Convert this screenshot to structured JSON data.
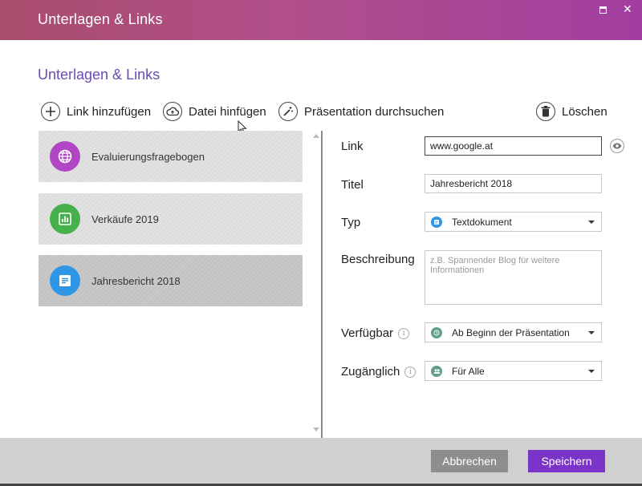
{
  "window": {
    "title": "Unterlagen & Links"
  },
  "heading": "Unterlagen & Links",
  "toolbar": {
    "add_link": "Link hinzufügen",
    "add_file": "Datei hinfügen",
    "search_presentation": "Präsentation durchsuchen",
    "delete": "Löschen"
  },
  "list": {
    "items": [
      {
        "label": "Evaluierungsfragebogen",
        "icon": "globe-icon",
        "color": "#b046c4"
      },
      {
        "label": "Verkäufe 2019",
        "icon": "bar-chart-icon",
        "color": "#46b14c"
      },
      {
        "label": "Jahresbericht 2018",
        "icon": "document-icon",
        "color": "#2f96e6",
        "selected": true
      }
    ]
  },
  "form": {
    "link_label": "Link",
    "link_value": "www.google.at",
    "title_label": "Titel",
    "title_value": "Jahresbericht 2018",
    "type_label": "Typ",
    "type_value": "Textdokument",
    "type_icon_color": "#2f96e6",
    "description_label": "Beschreibung",
    "description_placeholder": "z.B. Spannender Blog für weitere Informationen",
    "available_label": "Verfügbar",
    "available_value": "Ab Beginn der Präsentation",
    "access_label": "Zugänglich",
    "access_value": "Für Alle",
    "status_icon_color": "#5e9e8a"
  },
  "footer": {
    "cancel": "Abbrechen",
    "save": "Speichern"
  },
  "colors": {
    "accent": "#7a35c8",
    "heading": "#6a4bb3"
  }
}
